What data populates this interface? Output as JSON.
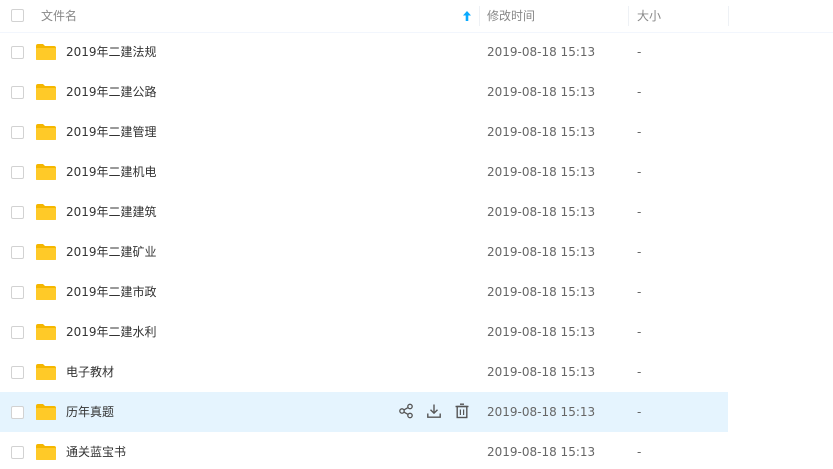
{
  "header": {
    "name_label": "文件名",
    "modified_label": "修改时间",
    "size_label": "大小"
  },
  "colors": {
    "folder": "#FFCA28",
    "folder_back": "#F5B700",
    "hover_row": "#E5F4FE",
    "sort_arrow": "#09AAFF",
    "icon_gray": "#555555"
  },
  "files": [
    {
      "name": "2019年二建法规",
      "modified": "2019-08-18 15:13",
      "size": "-"
    },
    {
      "name": "2019年二建公路",
      "modified": "2019-08-18 15:13",
      "size": "-"
    },
    {
      "name": "2019年二建管理",
      "modified": "2019-08-18 15:13",
      "size": "-"
    },
    {
      "name": "2019年二建机电",
      "modified": "2019-08-18 15:13",
      "size": "-"
    },
    {
      "name": "2019年二建建筑",
      "modified": "2019-08-18 15:13",
      "size": "-"
    },
    {
      "name": "2019年二建矿业",
      "modified": "2019-08-18 15:13",
      "size": "-"
    },
    {
      "name": "2019年二建市政",
      "modified": "2019-08-18 15:13",
      "size": "-"
    },
    {
      "name": "2019年二建水利",
      "modified": "2019-08-18 15:13",
      "size": "-"
    },
    {
      "name": "电子教材",
      "modified": "2019-08-18 15:13",
      "size": "-"
    },
    {
      "name": "历年真题",
      "modified": "2019-08-18 15:13",
      "size": "-"
    },
    {
      "name": "通关蓝宝书",
      "modified": "2019-08-18 15:13",
      "size": "-"
    }
  ]
}
